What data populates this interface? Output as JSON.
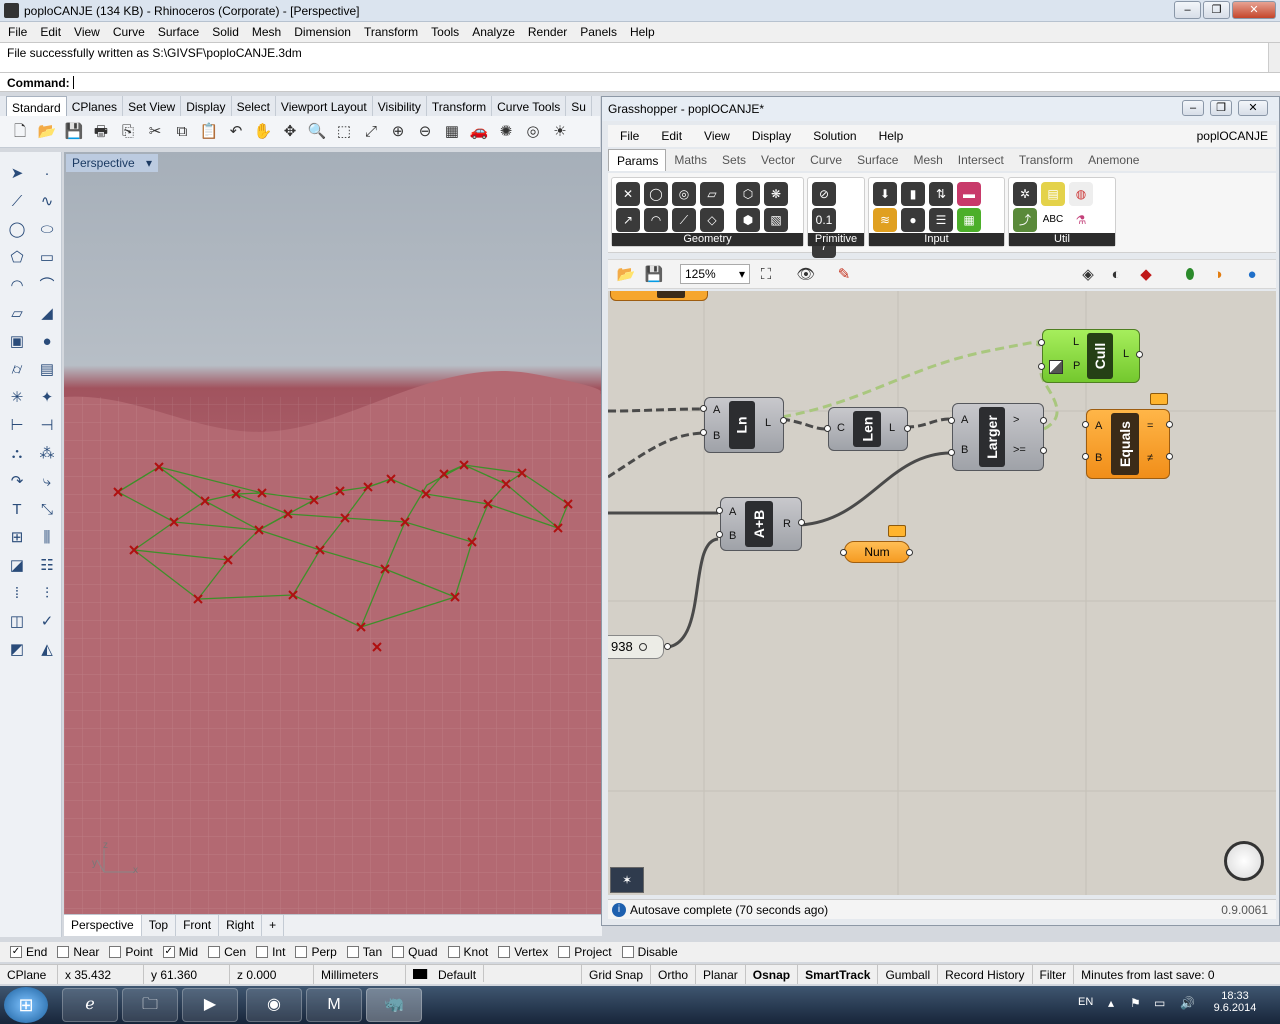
{
  "rhino": {
    "title": "poploCANJE (134 KB) - Rhinoceros (Corporate) - [Perspective]",
    "menu": [
      "File",
      "Edit",
      "View",
      "Curve",
      "Surface",
      "Solid",
      "Mesh",
      "Dimension",
      "Transform",
      "Tools",
      "Analyze",
      "Render",
      "Panels",
      "Help"
    ],
    "history_line": "File successfully written as S:\\GIVSF\\poploCANJE.3dm",
    "command_label": "Command:",
    "toolbar_tabs": [
      "Standard",
      "CPlanes",
      "Set View",
      "Display",
      "Select",
      "Viewport Layout",
      "Visibility",
      "Transform",
      "Curve Tools",
      "Su"
    ],
    "viewport_label": "Perspective",
    "viewport_tabs": [
      "Perspective",
      "Top",
      "Front",
      "Right",
      "+"
    ],
    "axis": {
      "z": "z",
      "y": "y",
      "x": "x"
    }
  },
  "grasshopper": {
    "title": "Grasshopper - poplOCANJE*",
    "menu": [
      "File",
      "Edit",
      "View",
      "Display",
      "Solution",
      "Help"
    ],
    "doc_name": "poplOCANJE",
    "tabs": [
      "Params",
      "Maths",
      "Sets",
      "Vector",
      "Curve",
      "Surface",
      "Mesh",
      "Intersect",
      "Transform",
      "Anemone"
    ],
    "ribbon_groups": [
      "Geometry",
      "Primitive",
      "Input",
      "Util"
    ],
    "zoom": "125%",
    "components": {
      "ln": {
        "label": "Ln",
        "in": [
          "A",
          "B"
        ],
        "out": [
          "L"
        ]
      },
      "len": {
        "label": "Len",
        "in": [
          "C"
        ],
        "out": [
          "L"
        ]
      },
      "larger": {
        "label": "Larger",
        "in": [
          "A",
          "B"
        ],
        "out": [
          ">",
          ">="
        ]
      },
      "cull": {
        "label": "Cull",
        "in": [
          "L",
          "P"
        ],
        "out": [
          "L"
        ]
      },
      "equals": {
        "label": "Equals",
        "in": [
          "A",
          "B"
        ],
        "out": [
          "=",
          "≠"
        ]
      },
      "add": {
        "label": "A+B",
        "in": [
          "A",
          "B"
        ],
        "out": [
          "R"
        ]
      },
      "num": {
        "label": "Num"
      },
      "panel_value": "938"
    },
    "status": "Autosave complete (70 seconds ago)",
    "version": "0.9.0061"
  },
  "osnap": [
    {
      "label": "End",
      "checked": true
    },
    {
      "label": "Near",
      "checked": false
    },
    {
      "label": "Point",
      "checked": false
    },
    {
      "label": "Mid",
      "checked": true
    },
    {
      "label": "Cen",
      "checked": false
    },
    {
      "label": "Int",
      "checked": false
    },
    {
      "label": "Perp",
      "checked": false
    },
    {
      "label": "Tan",
      "checked": false
    },
    {
      "label": "Quad",
      "checked": false
    },
    {
      "label": "Knot",
      "checked": false
    },
    {
      "label": "Vertex",
      "checked": false
    },
    {
      "label": "Project",
      "checked": false
    },
    {
      "label": "Disable",
      "checked": false
    }
  ],
  "statusbar": {
    "cplane": "CPlane",
    "x": "x 35.432",
    "y": "y 61.360",
    "z": "z 0.000",
    "units": "Millimeters",
    "layer": "Default",
    "toggles": [
      "Grid Snap",
      "Ortho",
      "Planar",
      "Osnap",
      "SmartTrack",
      "Gumball",
      "Record History",
      "Filter"
    ],
    "minutes": "Minutes from last save: 0"
  },
  "taskbar": {
    "lang": "EN",
    "time": "18:33",
    "date": "9.6.2014"
  },
  "colors": {
    "viewport_surface": "#b06470",
    "mesh_lines": "#3f8f2a",
    "points": "#b01010",
    "gh_canvas": "#d4d0c8",
    "gh_green": "#8fdc45",
    "gh_orange": "#f6a62d"
  }
}
